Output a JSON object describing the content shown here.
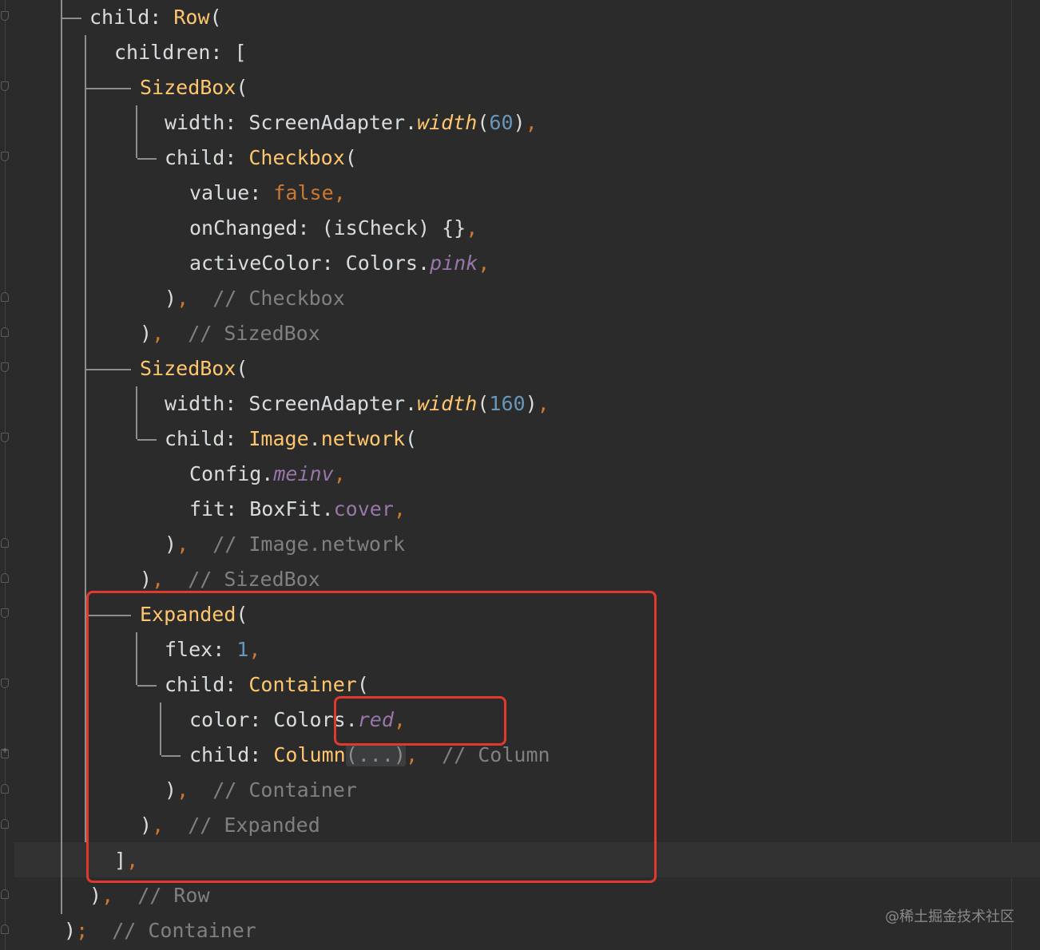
{
  "editor": {
    "lines": [
      {
        "indent": "  ",
        "tokens": [
          {
            "t": "child: ",
            "c": "p"
          },
          {
            "t": "Row",
            "c": "cls"
          },
          {
            "t": "(",
            "c": "p"
          }
        ]
      },
      {
        "indent": "    ",
        "tokens": [
          {
            "t": "children: [",
            "c": "p"
          }
        ]
      },
      {
        "indent": "      ",
        "tokens": [
          {
            "t": "SizedBox",
            "c": "cls"
          },
          {
            "t": "(",
            "c": "p"
          }
        ]
      },
      {
        "indent": "        ",
        "tokens": [
          {
            "t": "width: ScreenAdapter.",
            "c": "p"
          },
          {
            "t": "width",
            "c": "method"
          },
          {
            "t": "(",
            "c": "p"
          },
          {
            "t": "60",
            "c": "num"
          },
          {
            "t": ")",
            "c": "p"
          },
          {
            "t": ",",
            "c": "kw"
          }
        ]
      },
      {
        "indent": "        ",
        "tokens": [
          {
            "t": "child: ",
            "c": "p"
          },
          {
            "t": "Checkbox",
            "c": "cls"
          },
          {
            "t": "(",
            "c": "p"
          }
        ]
      },
      {
        "indent": "          ",
        "tokens": [
          {
            "t": "value: ",
            "c": "p"
          },
          {
            "t": "false",
            "c": "kw"
          },
          {
            "t": ",",
            "c": "kw"
          }
        ]
      },
      {
        "indent": "          ",
        "tokens": [
          {
            "t": "onChanged: (isCheck) {}",
            "c": "p"
          },
          {
            "t": ",",
            "c": "kw"
          }
        ]
      },
      {
        "indent": "          ",
        "tokens": [
          {
            "t": "activeColor: Colors.",
            "c": "p"
          },
          {
            "t": "pink",
            "c": "prop"
          },
          {
            "t": ",",
            "c": "kw"
          }
        ]
      },
      {
        "indent": "        ",
        "tokens": [
          {
            "t": ")",
            "c": "p"
          },
          {
            "t": ",  ",
            "c": "kw"
          },
          {
            "t": "// Checkbox",
            "c": "cmt"
          }
        ]
      },
      {
        "indent": "      ",
        "tokens": [
          {
            "t": ")",
            "c": "p"
          },
          {
            "t": ",  ",
            "c": "kw"
          },
          {
            "t": "// SizedBox",
            "c": "cmt"
          }
        ]
      },
      {
        "indent": "      ",
        "tokens": [
          {
            "t": "SizedBox",
            "c": "cls"
          },
          {
            "t": "(",
            "c": "p"
          }
        ]
      },
      {
        "indent": "        ",
        "tokens": [
          {
            "t": "width: ScreenAdapter.",
            "c": "p"
          },
          {
            "t": "width",
            "c": "method"
          },
          {
            "t": "(",
            "c": "p"
          },
          {
            "t": "160",
            "c": "num"
          },
          {
            "t": ")",
            "c": "p"
          },
          {
            "t": ",",
            "c": "kw"
          }
        ]
      },
      {
        "indent": "        ",
        "tokens": [
          {
            "t": "child: ",
            "c": "p"
          },
          {
            "t": "Image",
            "c": "cls"
          },
          {
            "t": ".",
            "c": "p"
          },
          {
            "t": "network",
            "c": "cls"
          },
          {
            "t": "(",
            "c": "p"
          }
        ]
      },
      {
        "indent": "          ",
        "tokens": [
          {
            "t": "Config.",
            "c": "p"
          },
          {
            "t": "meinv",
            "c": "prop"
          },
          {
            "t": ",",
            "c": "kw"
          }
        ]
      },
      {
        "indent": "          ",
        "tokens": [
          {
            "t": "fit: BoxFit.",
            "c": "p"
          },
          {
            "t": "cover",
            "c": "prop2"
          },
          {
            "t": ",",
            "c": "kw"
          }
        ]
      },
      {
        "indent": "        ",
        "tokens": [
          {
            "t": ")",
            "c": "p"
          },
          {
            "t": ",  ",
            "c": "kw"
          },
          {
            "t": "// Image.network",
            "c": "cmt"
          }
        ]
      },
      {
        "indent": "      ",
        "tokens": [
          {
            "t": ")",
            "c": "p"
          },
          {
            "t": ",  ",
            "c": "kw"
          },
          {
            "t": "// SizedBox",
            "c": "cmt"
          }
        ]
      },
      {
        "indent": "      ",
        "tokens": [
          {
            "t": "Expanded",
            "c": "cls"
          },
          {
            "t": "(",
            "c": "p"
          }
        ]
      },
      {
        "indent": "        ",
        "tokens": [
          {
            "t": "flex: ",
            "c": "p"
          },
          {
            "t": "1",
            "c": "num"
          },
          {
            "t": ",",
            "c": "kw"
          }
        ]
      },
      {
        "indent": "        ",
        "tokens": [
          {
            "t": "child: ",
            "c": "p"
          },
          {
            "t": "Container",
            "c": "cls"
          },
          {
            "t": "(",
            "c": "p"
          }
        ]
      },
      {
        "indent": "          ",
        "tokens": [
          {
            "t": "color: Colors.",
            "c": "p"
          },
          {
            "t": "red",
            "c": "prop"
          },
          {
            "t": ",",
            "c": "kw"
          }
        ]
      },
      {
        "indent": "          ",
        "tokens": [
          {
            "t": "child: ",
            "c": "p"
          },
          {
            "t": "Column",
            "c": "cls"
          },
          {
            "t": "(...)",
            "c": "fold-inline"
          },
          {
            "t": ",  ",
            "c": "kw"
          },
          {
            "t": "// Column",
            "c": "cmt"
          }
        ]
      },
      {
        "indent": "        ",
        "tokens": [
          {
            "t": ")",
            "c": "p"
          },
          {
            "t": ",  ",
            "c": "kw"
          },
          {
            "t": "// Container",
            "c": "cmt"
          }
        ]
      },
      {
        "indent": "      ",
        "tokens": [
          {
            "t": ")",
            "c": "p"
          },
          {
            "t": ",  ",
            "c": "kw"
          },
          {
            "t": "// Expanded",
            "c": "cmt"
          }
        ]
      },
      {
        "indent": "    ",
        "tokens": [
          {
            "t": "]",
            "c": "p"
          },
          {
            "t": ",",
            "c": "kw"
          }
        ]
      },
      {
        "indent": "  ",
        "tokens": [
          {
            "t": ")",
            "c": "p"
          },
          {
            "t": ",  ",
            "c": "kw"
          },
          {
            "t": "// Row",
            "c": "cmt"
          }
        ]
      },
      {
        "indent": "",
        "tokens": [
          {
            "t": ")",
            "c": "p"
          },
          {
            "t": ";  ",
            "c": "kw"
          },
          {
            "t": "// Container",
            "c": "cmt"
          }
        ]
      }
    ]
  },
  "watermark": "@稀土掘金技术社区",
  "colors": {
    "background": "#2b2b2b",
    "class": "#ffc66d",
    "keyword": "#cc7832",
    "number": "#6897bb",
    "property": "#9876aa",
    "comment": "#808080",
    "highlight_box": "#e03a2e"
  }
}
